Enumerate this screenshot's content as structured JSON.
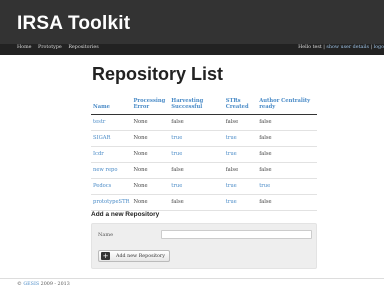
{
  "header": {
    "title": "IRSA Toolkit"
  },
  "nav": {
    "items": [
      "Home",
      "Prototype",
      "Repositories"
    ],
    "user_greeting": "Hello test |",
    "user_details_link": "show user details",
    "separator": "|",
    "logout_link": "logo"
  },
  "page": {
    "title": "Repository List"
  },
  "table": {
    "headers": [
      "Name",
      "Processing Error",
      "Harvesting Successful",
      "STRs Created",
      "Author Centrality ready"
    ],
    "rows": [
      {
        "name": "testr",
        "error": "None",
        "harvest": "false",
        "strs": "false",
        "centrality": "false"
      },
      {
        "name": "SIGAR",
        "error": "None",
        "harvest": "true",
        "strs": "true",
        "centrality": "false"
      },
      {
        "name": "Icdr",
        "error": "None",
        "harvest": "true",
        "strs": "true",
        "centrality": "false"
      },
      {
        "name": "new repo",
        "error": "None",
        "harvest": "false",
        "strs": "false",
        "centrality": "false"
      },
      {
        "name": "Pedocs",
        "error": "None",
        "harvest": "true",
        "strs": "true",
        "centrality": "true"
      },
      {
        "name": "prototypeSTR",
        "error": "None",
        "harvest": "false",
        "strs": "true",
        "centrality": "false"
      }
    ],
    "true_color": "#4a8bc7"
  },
  "add_form": {
    "title": "Add a new Repository",
    "name_label": "Name",
    "name_value": "",
    "button_icon": "plus-icon",
    "button_label": "Add new Repository"
  },
  "footer": {
    "prefix": "©",
    "org_link": "GESIS",
    "years": "2009 - 2013"
  }
}
